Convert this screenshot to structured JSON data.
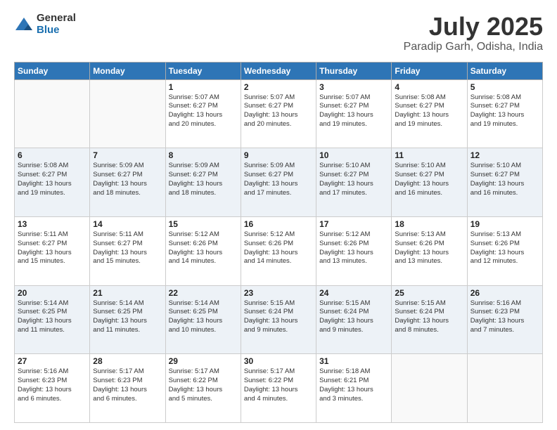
{
  "header": {
    "logo": {
      "general": "General",
      "blue": "Blue"
    },
    "title": "July 2025",
    "subtitle": "Paradip Garh, Odisha, India"
  },
  "weekdays": [
    "Sunday",
    "Monday",
    "Tuesday",
    "Wednesday",
    "Thursday",
    "Friday",
    "Saturday"
  ],
  "weeks": [
    [
      {
        "day": "",
        "info": ""
      },
      {
        "day": "",
        "info": ""
      },
      {
        "day": "1",
        "info": "Sunrise: 5:07 AM\nSunset: 6:27 PM\nDaylight: 13 hours\nand 20 minutes."
      },
      {
        "day": "2",
        "info": "Sunrise: 5:07 AM\nSunset: 6:27 PM\nDaylight: 13 hours\nand 20 minutes."
      },
      {
        "day": "3",
        "info": "Sunrise: 5:07 AM\nSunset: 6:27 PM\nDaylight: 13 hours\nand 19 minutes."
      },
      {
        "day": "4",
        "info": "Sunrise: 5:08 AM\nSunset: 6:27 PM\nDaylight: 13 hours\nand 19 minutes."
      },
      {
        "day": "5",
        "info": "Sunrise: 5:08 AM\nSunset: 6:27 PM\nDaylight: 13 hours\nand 19 minutes."
      }
    ],
    [
      {
        "day": "6",
        "info": "Sunrise: 5:08 AM\nSunset: 6:27 PM\nDaylight: 13 hours\nand 19 minutes."
      },
      {
        "day": "7",
        "info": "Sunrise: 5:09 AM\nSunset: 6:27 PM\nDaylight: 13 hours\nand 18 minutes."
      },
      {
        "day": "8",
        "info": "Sunrise: 5:09 AM\nSunset: 6:27 PM\nDaylight: 13 hours\nand 18 minutes."
      },
      {
        "day": "9",
        "info": "Sunrise: 5:09 AM\nSunset: 6:27 PM\nDaylight: 13 hours\nand 17 minutes."
      },
      {
        "day": "10",
        "info": "Sunrise: 5:10 AM\nSunset: 6:27 PM\nDaylight: 13 hours\nand 17 minutes."
      },
      {
        "day": "11",
        "info": "Sunrise: 5:10 AM\nSunset: 6:27 PM\nDaylight: 13 hours\nand 16 minutes."
      },
      {
        "day": "12",
        "info": "Sunrise: 5:10 AM\nSunset: 6:27 PM\nDaylight: 13 hours\nand 16 minutes."
      }
    ],
    [
      {
        "day": "13",
        "info": "Sunrise: 5:11 AM\nSunset: 6:27 PM\nDaylight: 13 hours\nand 15 minutes."
      },
      {
        "day": "14",
        "info": "Sunrise: 5:11 AM\nSunset: 6:27 PM\nDaylight: 13 hours\nand 15 minutes."
      },
      {
        "day": "15",
        "info": "Sunrise: 5:12 AM\nSunset: 6:26 PM\nDaylight: 13 hours\nand 14 minutes."
      },
      {
        "day": "16",
        "info": "Sunrise: 5:12 AM\nSunset: 6:26 PM\nDaylight: 13 hours\nand 14 minutes."
      },
      {
        "day": "17",
        "info": "Sunrise: 5:12 AM\nSunset: 6:26 PM\nDaylight: 13 hours\nand 13 minutes."
      },
      {
        "day": "18",
        "info": "Sunrise: 5:13 AM\nSunset: 6:26 PM\nDaylight: 13 hours\nand 13 minutes."
      },
      {
        "day": "19",
        "info": "Sunrise: 5:13 AM\nSunset: 6:26 PM\nDaylight: 13 hours\nand 12 minutes."
      }
    ],
    [
      {
        "day": "20",
        "info": "Sunrise: 5:14 AM\nSunset: 6:25 PM\nDaylight: 13 hours\nand 11 minutes."
      },
      {
        "day": "21",
        "info": "Sunrise: 5:14 AM\nSunset: 6:25 PM\nDaylight: 13 hours\nand 11 minutes."
      },
      {
        "day": "22",
        "info": "Sunrise: 5:14 AM\nSunset: 6:25 PM\nDaylight: 13 hours\nand 10 minutes."
      },
      {
        "day": "23",
        "info": "Sunrise: 5:15 AM\nSunset: 6:24 PM\nDaylight: 13 hours\nand 9 minutes."
      },
      {
        "day": "24",
        "info": "Sunrise: 5:15 AM\nSunset: 6:24 PM\nDaylight: 13 hours\nand 9 minutes."
      },
      {
        "day": "25",
        "info": "Sunrise: 5:15 AM\nSunset: 6:24 PM\nDaylight: 13 hours\nand 8 minutes."
      },
      {
        "day": "26",
        "info": "Sunrise: 5:16 AM\nSunset: 6:23 PM\nDaylight: 13 hours\nand 7 minutes."
      }
    ],
    [
      {
        "day": "27",
        "info": "Sunrise: 5:16 AM\nSunset: 6:23 PM\nDaylight: 13 hours\nand 6 minutes."
      },
      {
        "day": "28",
        "info": "Sunrise: 5:17 AM\nSunset: 6:23 PM\nDaylight: 13 hours\nand 6 minutes."
      },
      {
        "day": "29",
        "info": "Sunrise: 5:17 AM\nSunset: 6:22 PM\nDaylight: 13 hours\nand 5 minutes."
      },
      {
        "day": "30",
        "info": "Sunrise: 5:17 AM\nSunset: 6:22 PM\nDaylight: 13 hours\nand 4 minutes."
      },
      {
        "day": "31",
        "info": "Sunrise: 5:18 AM\nSunset: 6:21 PM\nDaylight: 13 hours\nand 3 minutes."
      },
      {
        "day": "",
        "info": ""
      },
      {
        "day": "",
        "info": ""
      }
    ]
  ]
}
